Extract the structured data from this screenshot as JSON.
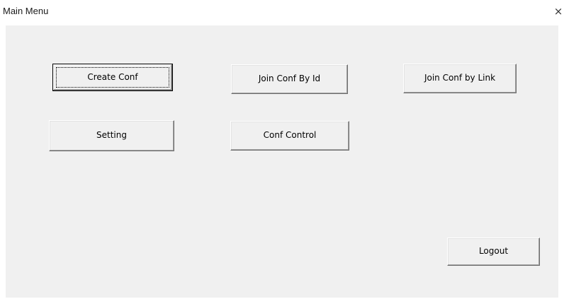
{
  "window": {
    "title": "Main Menu",
    "close_glyph": "×"
  },
  "buttons": {
    "create_conf": "Create Conf",
    "join_conf_by_id": "Join Conf By Id",
    "join_conf_by_link": "Join Conf by Link",
    "setting": "Setting",
    "conf_control": "Conf Control",
    "logout": "Logout"
  },
  "icons": {
    "close": "close-icon"
  },
  "colors": {
    "client_background": "#f0f0f0",
    "titlebar_background": "#ffffff",
    "button_face": "#f0f0f0"
  }
}
